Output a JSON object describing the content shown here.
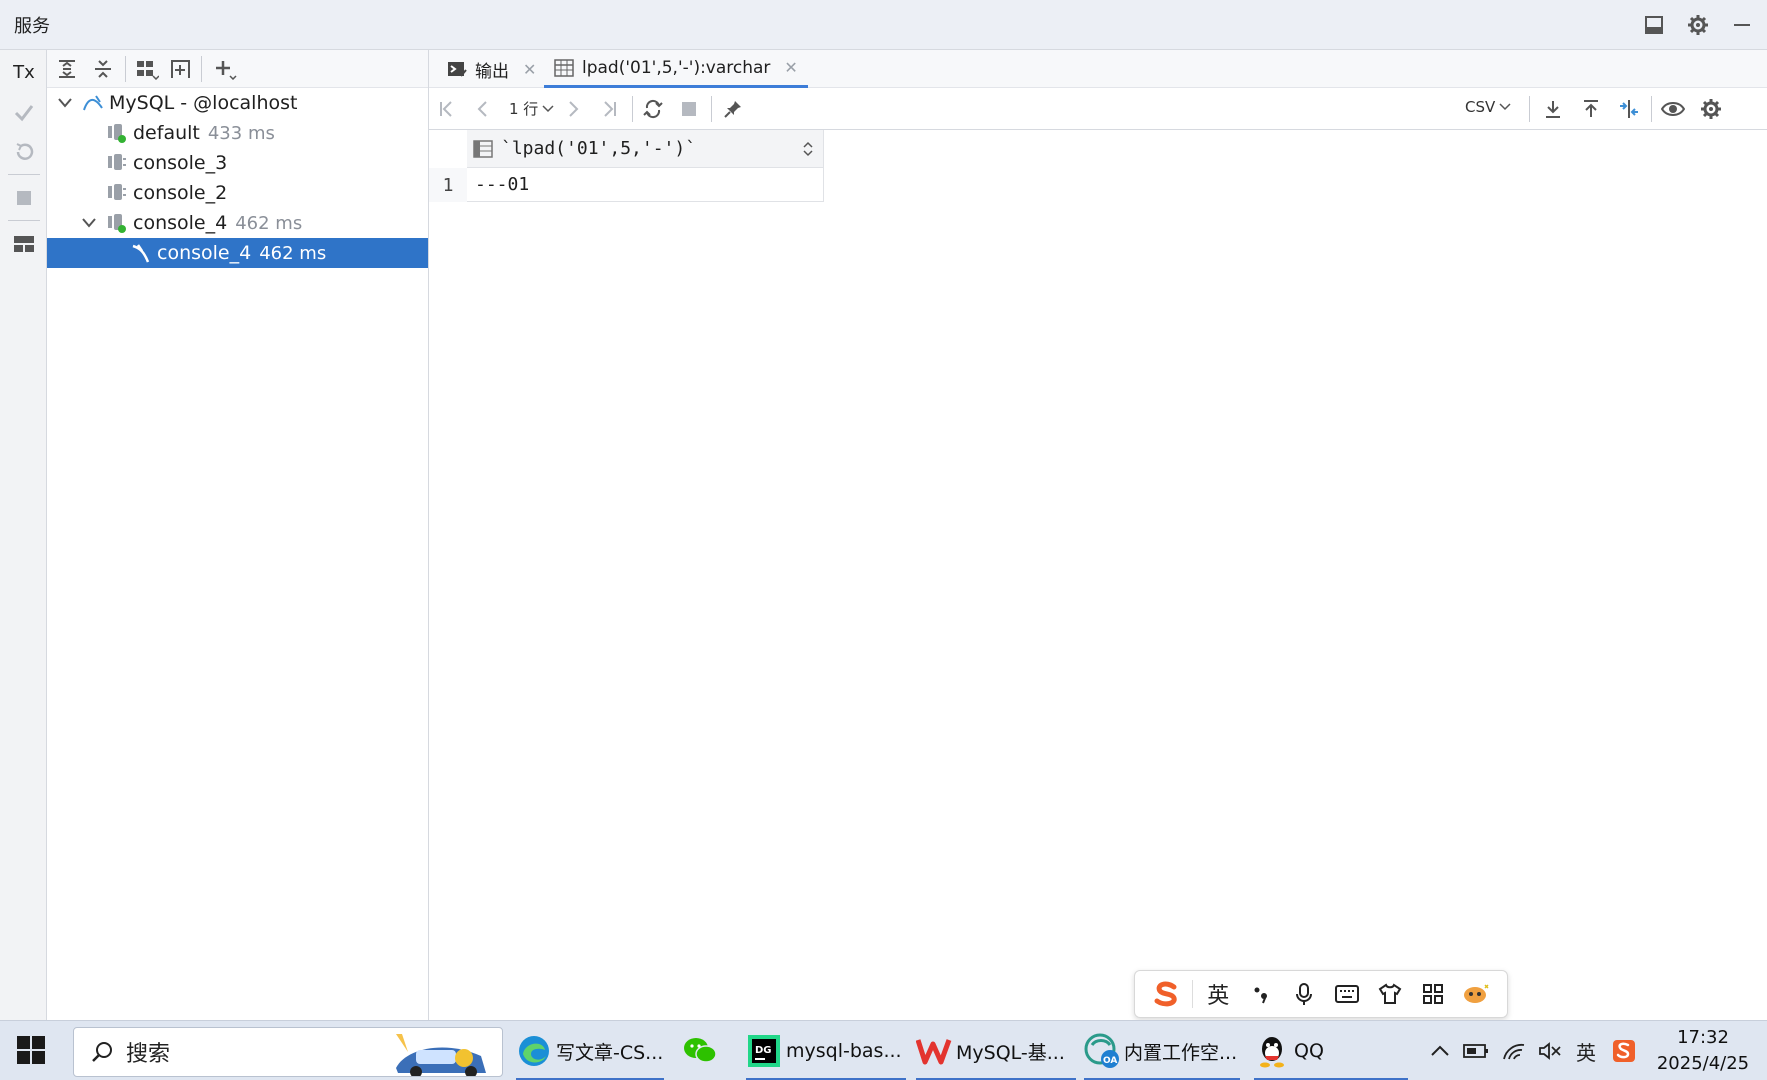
{
  "window": {
    "title": "服务",
    "icons": [
      "layout-icon",
      "gear-icon",
      "minimize-icon"
    ]
  },
  "vtoolbar": {
    "tx_label": "Tx"
  },
  "tree": {
    "items": [
      {
        "label": "MySQL - @localhost",
        "ms": ""
      },
      {
        "label": "default",
        "ms": "433 ms"
      },
      {
        "label": "console_3",
        "ms": ""
      },
      {
        "label": "console_2",
        "ms": ""
      },
      {
        "label": "console_4",
        "ms": "462 ms"
      },
      {
        "label": "console_4",
        "ms": "462 ms"
      }
    ]
  },
  "tabs": [
    {
      "label": "输出"
    },
    {
      "label": "lpad('01',5,'-'):varchar"
    }
  ],
  "result_toolbar": {
    "rows_label": "1 行",
    "format_label": "CSV"
  },
  "grid": {
    "column": "`lpad('01',5,'-')`",
    "rows": [
      {
        "num": "1",
        "value": "---01"
      }
    ]
  },
  "ime": {
    "lang_label": "英"
  },
  "taskbar": {
    "search_label": "搜索",
    "apps": [
      {
        "label": "写文章-CS..."
      },
      {
        "label": ""
      },
      {
        "label": "mysql-bas..."
      },
      {
        "label": "MySQL-基..."
      },
      {
        "label": "内置工作空..."
      },
      {
        "label": "QQ"
      }
    ],
    "tray_lang": "英",
    "time": "17:32",
    "date": "2025/4/25"
  },
  "colors": {
    "accent": "#2f74c8",
    "mysql_blue": "#3d8fd6",
    "green_dot": "#33b233"
  }
}
